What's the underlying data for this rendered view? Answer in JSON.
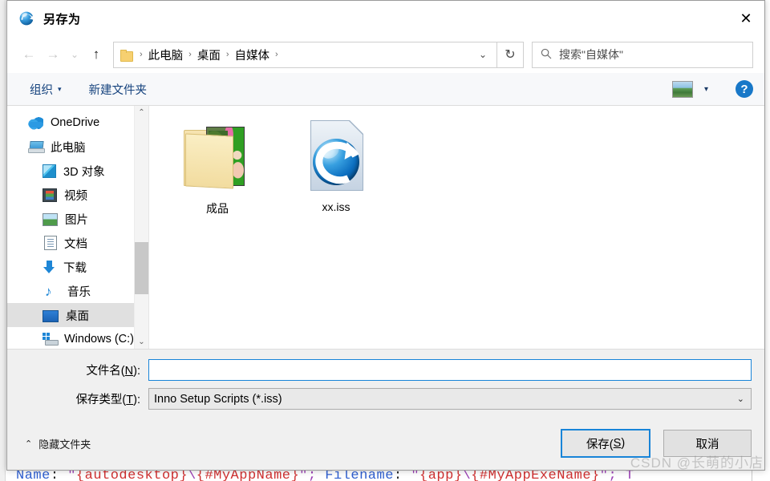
{
  "window": {
    "title": "另存为",
    "title_icon": "inno-setup-globe-icon",
    "close_label": "✕"
  },
  "nav": {
    "back_icon": "arrow-left-icon",
    "forward_icon": "arrow-right-icon",
    "recent_icon": "chevron-down-icon",
    "up_icon": "arrow-up-icon",
    "breadcrumb": [
      "此电脑",
      "桌面",
      "自媒体"
    ],
    "breadcrumb_separator": "›",
    "breadcrumb_chevron": "⌄",
    "refresh_icon": "refresh-icon",
    "search_placeholder": "搜索\"自媒体\"",
    "search_icon": "search-icon"
  },
  "toolbar": {
    "organize_label": "组织",
    "organize_caret": "▾",
    "new_folder_label": "新建文件夹",
    "view_icon": "view-mode-picture-icon",
    "view_caret": "▾",
    "help_label": "?"
  },
  "sidebar": {
    "items": [
      {
        "label": "OneDrive",
        "icon": "onedrive-cloud-icon",
        "indent": 1,
        "selected": false
      },
      {
        "label": "此电脑",
        "icon": "this-pc-icon",
        "indent": 1,
        "selected": false
      },
      {
        "label": "3D 对象",
        "icon": "3d-objects-icon",
        "indent": 2,
        "selected": false
      },
      {
        "label": "视频",
        "icon": "videos-icon",
        "indent": 2,
        "selected": false
      },
      {
        "label": "图片",
        "icon": "pictures-icon",
        "indent": 2,
        "selected": false
      },
      {
        "label": "文档",
        "icon": "documents-icon",
        "indent": 2,
        "selected": false
      },
      {
        "label": "下载",
        "icon": "downloads-icon",
        "indent": 2,
        "selected": false
      },
      {
        "label": "音乐",
        "icon": "music-icon",
        "indent": 2,
        "selected": false
      },
      {
        "label": "桌面",
        "icon": "desktop-icon",
        "indent": 2,
        "selected": true
      },
      {
        "label": "Windows (C:)",
        "icon": "windows-drive-icon",
        "indent": 2,
        "selected": false
      }
    ],
    "scroll_up_icon": "⌃",
    "scroll_down_icon": "⌄"
  },
  "files": [
    {
      "name": "成品",
      "type": "folder",
      "icon": "folder-with-photo-thumbnail"
    },
    {
      "name": "xx.iss",
      "type": "file",
      "icon": "inno-setup-script-icon"
    }
  ],
  "form": {
    "filename_label_pre": "文件名(",
    "filename_label_key": "N",
    "filename_label_post": "):",
    "filename_value": "",
    "filename_placeholder": "",
    "filetype_label_pre": "保存类型(",
    "filetype_label_key": "T",
    "filetype_label_post": "):",
    "filetype_value": "Inno Setup Scripts (*.iss)",
    "filetype_chevron": "⌄"
  },
  "footer": {
    "hide_folders_caret": "⌃",
    "hide_folders_label": "隐藏文件夹",
    "save_label_pre": "保存(",
    "save_label_key": "S",
    "save_label_post": ")",
    "cancel_label": "取消"
  },
  "background": {
    "code_line": "Name: \"{autodesktop}\\{#MyAppName}\"; Filename: \"{app}\\{#MyAppExeName}\"; T",
    "code_tokens": [
      {
        "text": "Name",
        "kind": "key"
      },
      {
        "text": ": ",
        "kind": "pun"
      },
      {
        "text": "\"",
        "kind": "str"
      },
      {
        "text": "{autodesktop}",
        "kind": "br"
      },
      {
        "text": "\\",
        "kind": "str"
      },
      {
        "text": "{#MyAppName}",
        "kind": "br"
      },
      {
        "text": "\"; ",
        "kind": "str"
      },
      {
        "text": "Filename",
        "kind": "key"
      },
      {
        "text": ": ",
        "kind": "pun"
      },
      {
        "text": "\"",
        "kind": "str"
      },
      {
        "text": "{app}",
        "kind": "br"
      },
      {
        "text": "\\",
        "kind": "str"
      },
      {
        "text": "{#MyAppExeName}",
        "kind": "br"
      },
      {
        "text": "\"; T",
        "kind": "str"
      }
    ],
    "watermark": "CSDN @长萌的小店"
  },
  "colors": {
    "accent": "#1884d8",
    "dialog_bg": "#f0f0f0",
    "selection": "#e0e0e0",
    "link_text": "#16437e",
    "help_blue": "#1878c8"
  }
}
